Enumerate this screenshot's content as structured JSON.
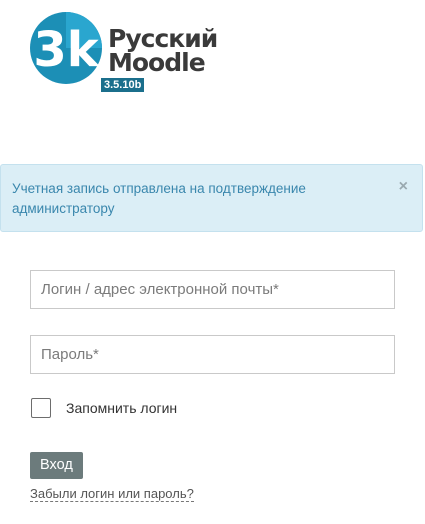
{
  "logo": {
    "mark_text": "3k",
    "line1": "Русский",
    "line2": "Moodle",
    "version": "3.5.10b",
    "colors": {
      "teal": "#1c8fb6",
      "dark_teal": "#1b6f8c",
      "text": "#3a3a3a"
    }
  },
  "alert": {
    "message": "Учетная запись отправлена на подтверждение администратору",
    "close_icon": "×"
  },
  "form": {
    "username_placeholder": "Логин / адрес электронной почты*",
    "password_placeholder": "Пароль*",
    "remember_label": "Запомнить логин",
    "remember_checked": false,
    "submit_label": "Вход",
    "forgot_link": "Забыли логин или пароль?"
  },
  "colors": {
    "alert_bg": "#dbeef6",
    "alert_text": "#3a87ad",
    "button_bg": "#6c7b7c"
  }
}
